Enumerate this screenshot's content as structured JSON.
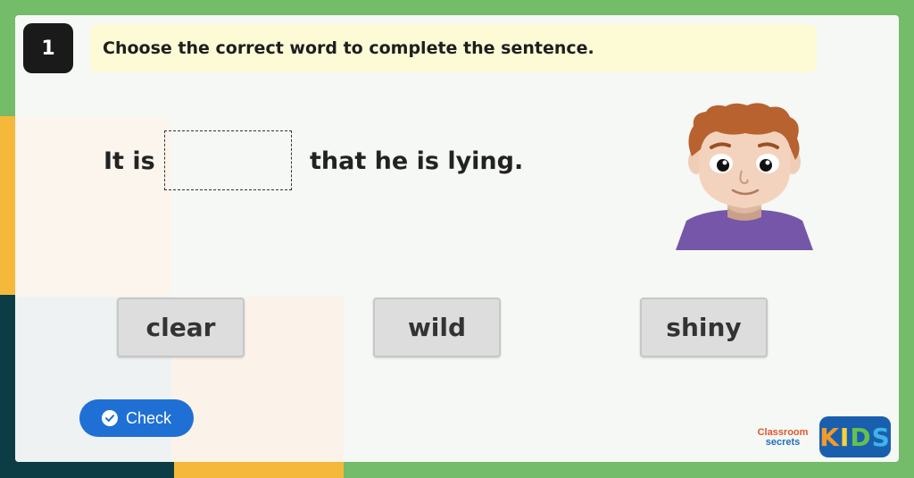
{
  "question": {
    "number": "1",
    "instruction": "Choose the correct word to complete the sentence."
  },
  "sentence": {
    "before": "It is",
    "after": "that he is lying."
  },
  "choices": [
    {
      "label": "clear"
    },
    {
      "label": "wild"
    },
    {
      "label": "shiny"
    }
  ],
  "check_button": {
    "label": "Check",
    "icon": "check-circle-icon"
  },
  "branding": {
    "classroom": "Classroom",
    "secrets": "secrets",
    "kids_letters": [
      "K",
      "I",
      "D",
      "S"
    ]
  },
  "colors": {
    "frame": "#74bb6a",
    "instruction_bg": "#fdfbd6",
    "button_blue": "#1f70d4",
    "choice_bg": "#dddddd"
  }
}
